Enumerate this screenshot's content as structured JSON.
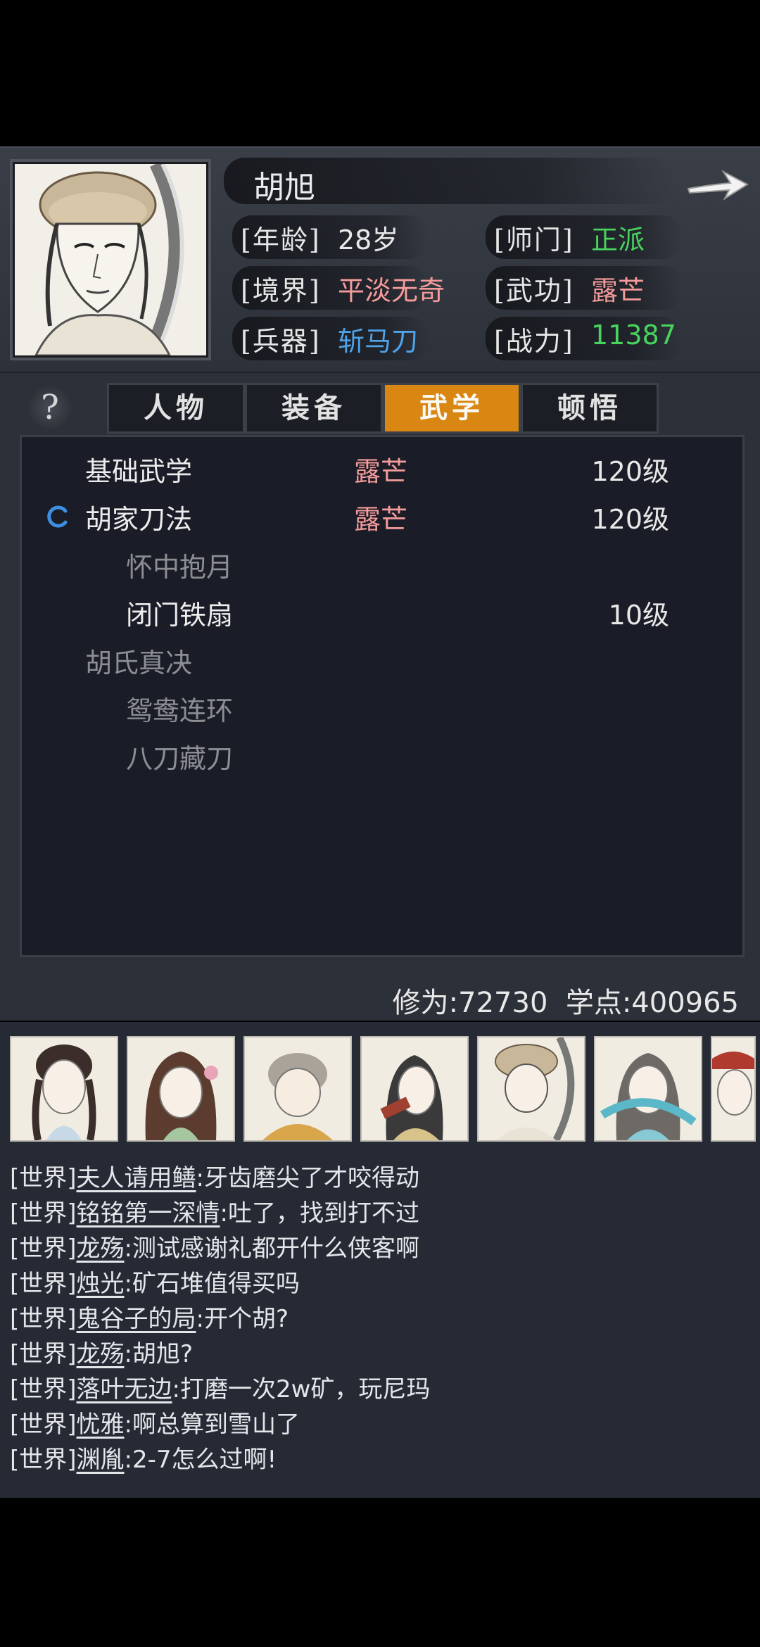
{
  "character": {
    "name": "胡旭",
    "attributes": [
      {
        "label": "[年龄]",
        "value": "28岁",
        "color": "#e8e8e8"
      },
      {
        "label": "[师门]",
        "value": "正派",
        "color": "#47d35e"
      },
      {
        "label": "[境界]",
        "value": "平淡无奇",
        "color": "#f59b9b"
      },
      {
        "label": "[武功]",
        "value": "露芒",
        "color": "#f59b9b"
      },
      {
        "label": "[兵器]",
        "value": "斩马刀",
        "color": "#4fa3e8"
      },
      {
        "label": "[战力]",
        "value": "11387",
        "color": "#47d35e"
      }
    ]
  },
  "help_label": "?",
  "tabs": [
    {
      "label": "人物",
      "active": false
    },
    {
      "label": "装备",
      "active": false
    },
    {
      "label": "武学",
      "active": true
    },
    {
      "label": "顿悟",
      "active": false
    }
  ],
  "skills": [
    {
      "name": "基础武学",
      "style": "露芒",
      "level": "120级",
      "indent": 0,
      "color": "#ececec",
      "active": false
    },
    {
      "name": "胡家刀法",
      "style": "露芒",
      "level": "120级",
      "indent": 0,
      "color": "#ececec",
      "active": true
    },
    {
      "name": "怀中抱月",
      "style": "",
      "level": "",
      "indent": 1,
      "color": "#8c8e94",
      "active": false
    },
    {
      "name": "闭门铁扇",
      "style": "",
      "level": "10级",
      "indent": 1,
      "color": "#ececec",
      "active": false
    },
    {
      "name": "胡氏真决",
      "style": "",
      "level": "",
      "indent": 0,
      "color": "#8c8e94",
      "active": false
    },
    {
      "name": "鸳鸯连环",
      "style": "",
      "level": "",
      "indent": 1,
      "color": "#8c8e94",
      "active": false
    },
    {
      "name": "八刀藏刀",
      "style": "",
      "level": "",
      "indent": 1,
      "color": "#8c8e94",
      "active": false
    }
  ],
  "stats": {
    "text": "修为:72730  学点:400965"
  },
  "chat": {
    "avatars": [
      "avatar-girl-braids",
      "avatar-lady-flower",
      "avatar-monk",
      "avatar-scholar-fan",
      "avatar-hero-furhat",
      "avatar-swordswoman",
      "avatar-elder"
    ],
    "messages": [
      {
        "channel": "[世界]",
        "user": "夫人请用鳝",
        "text": ":牙齿磨尖了才咬得动"
      },
      {
        "channel": "[世界]",
        "user": "铭铭第一深情",
        "text": ":吐了，找到打不过"
      },
      {
        "channel": "[世界]",
        "user": "龙殇",
        "text": ":测试感谢礼都开什么侠客啊"
      },
      {
        "channel": "[世界]",
        "user": "烛光",
        "text": ":矿石堆值得买吗"
      },
      {
        "channel": "[世界]",
        "user": "鬼谷子的局",
        "text": ":开个胡?"
      },
      {
        "channel": "[世界]",
        "user": "龙殇",
        "text": ":胡旭?"
      },
      {
        "channel": "[世界]",
        "user": "落叶无边",
        "text": ":打磨一次2w矿，玩尼玛"
      },
      {
        "channel": "[世界]",
        "user": "忧雅",
        "text": ":啊总算到雪山了"
      },
      {
        "channel": "[世界]",
        "user": "渊胤",
        "text": ":2-7怎么过啊!"
      }
    ]
  }
}
